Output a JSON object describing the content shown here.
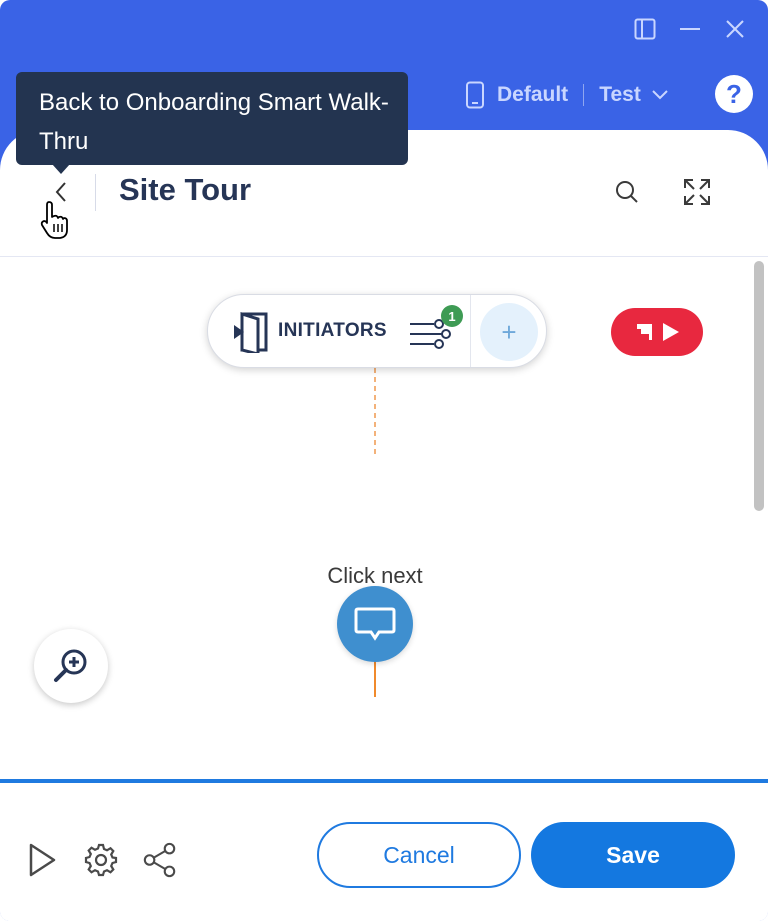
{
  "window": {
    "controls": [
      "sidebar-toggle",
      "minimize",
      "close"
    ]
  },
  "topbar": {
    "environment_label": "Default",
    "mode_label": "Test",
    "help_label": "?"
  },
  "tooltip": {
    "text": "Back to Onboarding Smart Walk-Thru"
  },
  "header": {
    "title": "Site Tour"
  },
  "canvas": {
    "initiators": {
      "label": "INITIATORS",
      "count": "1",
      "add_label": "+"
    },
    "steps": [
      {
        "label": "Click next"
      },
      {
        "label": ""
      }
    ]
  },
  "footer": {
    "cancel_label": "Cancel",
    "save_label": "Save"
  },
  "colors": {
    "topbar": "#3a63e6",
    "primary": "#1478e0",
    "node": "#3f8fcf",
    "play_flag": "#e8283f",
    "badge": "#3e9b54",
    "connector": "#f08a2c"
  }
}
